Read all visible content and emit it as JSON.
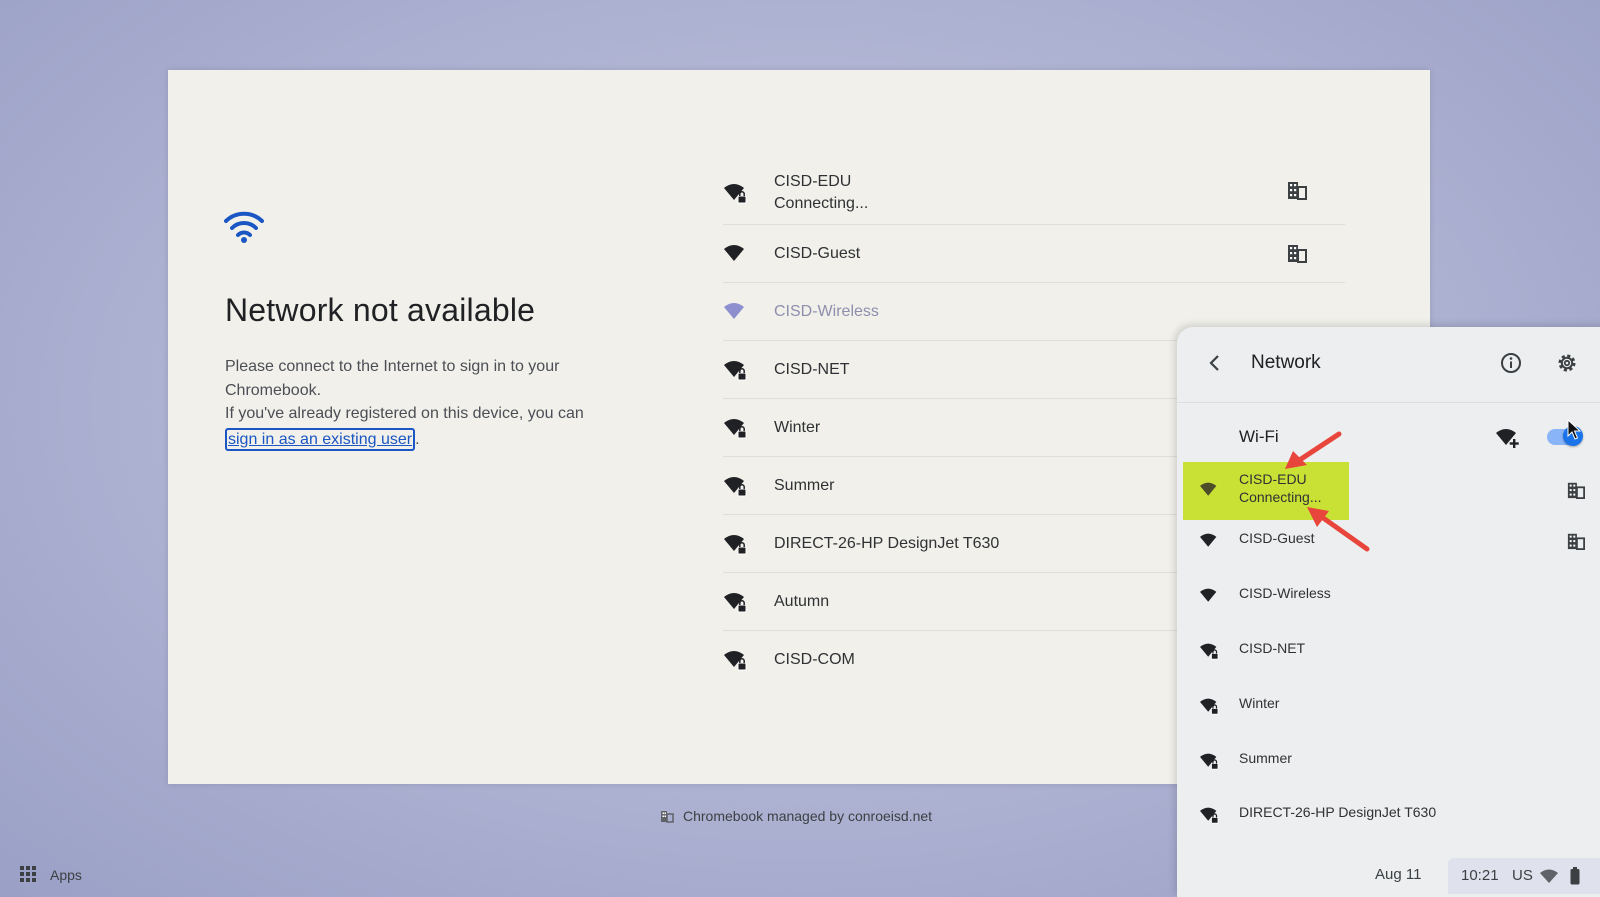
{
  "dialog": {
    "title": "Network not available",
    "desc_line1": "Please connect to the Internet to sign in to your Chromebook.",
    "desc_line2": "If you've already registered on this device, you can",
    "link": "sign in as an existing user",
    "link_suffix": "."
  },
  "networks": [
    {
      "name": "CISD-EDU",
      "status": "Connecting...",
      "secure": true,
      "enterprise": true,
      "disabled": false
    },
    {
      "name": "CISD-Guest",
      "status": "",
      "secure": false,
      "enterprise": true,
      "disabled": false
    },
    {
      "name": "CISD-Wireless",
      "status": "",
      "secure": false,
      "enterprise": false,
      "disabled": true
    },
    {
      "name": "CISD-NET",
      "status": "",
      "secure": true,
      "enterprise": false,
      "disabled": false
    },
    {
      "name": "Winter",
      "status": "",
      "secure": true,
      "enterprise": false,
      "disabled": false
    },
    {
      "name": "Summer",
      "status": "",
      "secure": true,
      "enterprise": false,
      "disabled": false
    },
    {
      "name": "DIRECT-26-HP DesignJet T630",
      "status": "",
      "secure": true,
      "enterprise": false,
      "disabled": false
    },
    {
      "name": "Autumn",
      "status": "",
      "secure": true,
      "enterprise": false,
      "disabled": false
    },
    {
      "name": "CISD-COM",
      "status": "",
      "secure": true,
      "enterprise": false,
      "disabled": false
    }
  ],
  "managed": "Chromebook managed by conroeisd.net",
  "panel": {
    "title": "Network",
    "wifi_label": "Wi-Fi",
    "wifi_enabled": true,
    "highlight_color": "#c9e135",
    "arrow_color": "#e8453c",
    "items": [
      {
        "name": "CISD-EDU",
        "status": "Connecting...",
        "secure": false,
        "enterprise": true
      },
      {
        "name": "CISD-Guest",
        "status": "",
        "secure": false,
        "enterprise": true
      },
      {
        "name": "CISD-Wireless",
        "status": "",
        "secure": false,
        "enterprise": false
      },
      {
        "name": "CISD-NET",
        "status": "",
        "secure": true,
        "enterprise": false
      },
      {
        "name": "Winter",
        "status": "",
        "secure": true,
        "enterprise": false
      },
      {
        "name": "Summer",
        "status": "",
        "secure": true,
        "enterprise": false
      },
      {
        "name": "DIRECT-26-HP DesignJet T630",
        "status": "",
        "secure": true,
        "enterprise": false
      }
    ]
  },
  "shelf": {
    "apps_label": "Apps",
    "date": "Aug 11",
    "time": "10:21",
    "locale": "US"
  }
}
